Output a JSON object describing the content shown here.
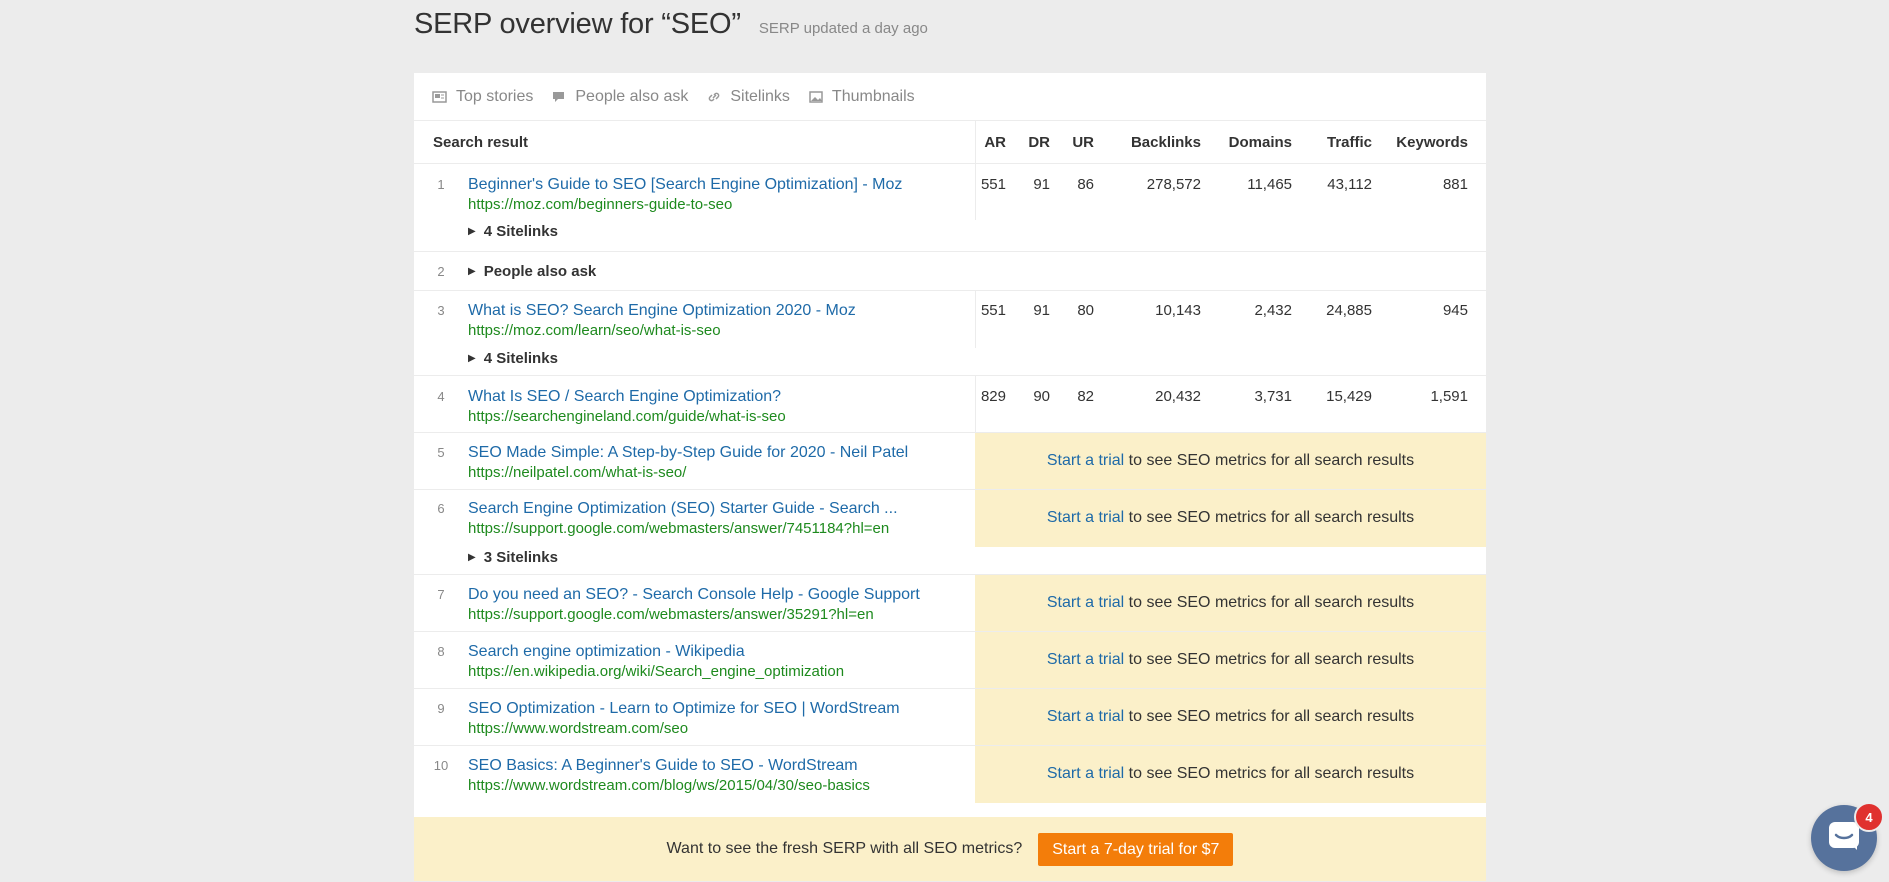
{
  "header": {
    "title": "SERP overview for “SEO”",
    "updated": "SERP updated a day ago"
  },
  "features": [
    {
      "icon": "newspaper-icon",
      "label": "Top stories"
    },
    {
      "icon": "speech-bubble-icon",
      "label": "People also ask"
    },
    {
      "icon": "link-icon",
      "label": "Sitelinks"
    },
    {
      "icon": "image-icon",
      "label": "Thumbnails"
    }
  ],
  "table": {
    "columns": {
      "result": "Search result",
      "ar": "AR",
      "dr": "DR",
      "ur": "UR",
      "backlinks": "Backlinks",
      "domains": "Domains",
      "traffic": "Traffic",
      "keywords": "Keywords"
    },
    "rows": [
      {
        "rank": "1",
        "title": "Beginner's Guide to SEO [Search Engine Optimization] - Moz",
        "url": "https://moz.com/beginners-guide-to-seo",
        "ar": "551",
        "dr": "91",
        "ur": "86",
        "backlinks": "278,572",
        "domains": "11,465",
        "traffic": "43,112",
        "keywords": "881",
        "sitelinks": "4 Sitelinks"
      },
      {
        "rank": "2",
        "feature": "People also ask"
      },
      {
        "rank": "3",
        "title": "What is SEO? Search Engine Optimization 2020 - Moz",
        "url": "https://moz.com/learn/seo/what-is-seo",
        "ar": "551",
        "dr": "91",
        "ur": "80",
        "backlinks": "10,143",
        "domains": "2,432",
        "traffic": "24,885",
        "keywords": "945",
        "sitelinks": "4 Sitelinks"
      },
      {
        "rank": "4",
        "title": "What Is SEO / Search Engine Optimization?",
        "url": "https://searchengineland.com/guide/what-is-seo",
        "ar": "829",
        "dr": "90",
        "ur": "82",
        "backlinks": "20,432",
        "domains": "3,731",
        "traffic": "15,429",
        "keywords": "1,591"
      },
      {
        "rank": "5",
        "title": "SEO Made Simple: A Step-by-Step Guide for 2020 - Neil Patel",
        "url": "https://neilpatel.com/what-is-seo/"
      },
      {
        "rank": "6",
        "title": "Search Engine Optimization (SEO) Starter Guide - Search ...",
        "url": "https://support.google.com/webmasters/answer/7451184?hl=en",
        "sitelinks": "3 Sitelinks"
      },
      {
        "rank": "7",
        "title": "Do you need an SEO? - Search Console Help - Google Support",
        "url": "https://support.google.com/webmasters/answer/35291?hl=en"
      },
      {
        "rank": "8",
        "title": "Search engine optimization - Wikipedia",
        "url": "https://en.wikipedia.org/wiki/Search_engine_optimization"
      },
      {
        "rank": "9",
        "title": "SEO Optimization - Learn to Optimize for SEO | WordStream",
        "url": "https://www.wordstream.com/seo"
      },
      {
        "rank": "10",
        "title": "SEO Basics: A Beginner's Guide to SEO - WordStream",
        "url": "https://www.wordstream.com/blog/ws/2015/04/30/seo-basics"
      }
    ],
    "trial_link": "Start a trial",
    "trial_text": " to see SEO metrics for all search results"
  },
  "cta": {
    "text": "Want to see the fresh SERP with all SEO metrics?",
    "button": "Start a 7-day trial for $7"
  },
  "chat": {
    "badge": "4",
    "icon": "chat-icon"
  },
  "colors": {
    "background": "#ececec",
    "link": "#1e6aa8",
    "url": "#1e8a1e",
    "trial_bg": "#fbf0c9",
    "cta_button": "#f37d0a",
    "chat_bg": "#56729c",
    "badge": "#e0312f"
  }
}
